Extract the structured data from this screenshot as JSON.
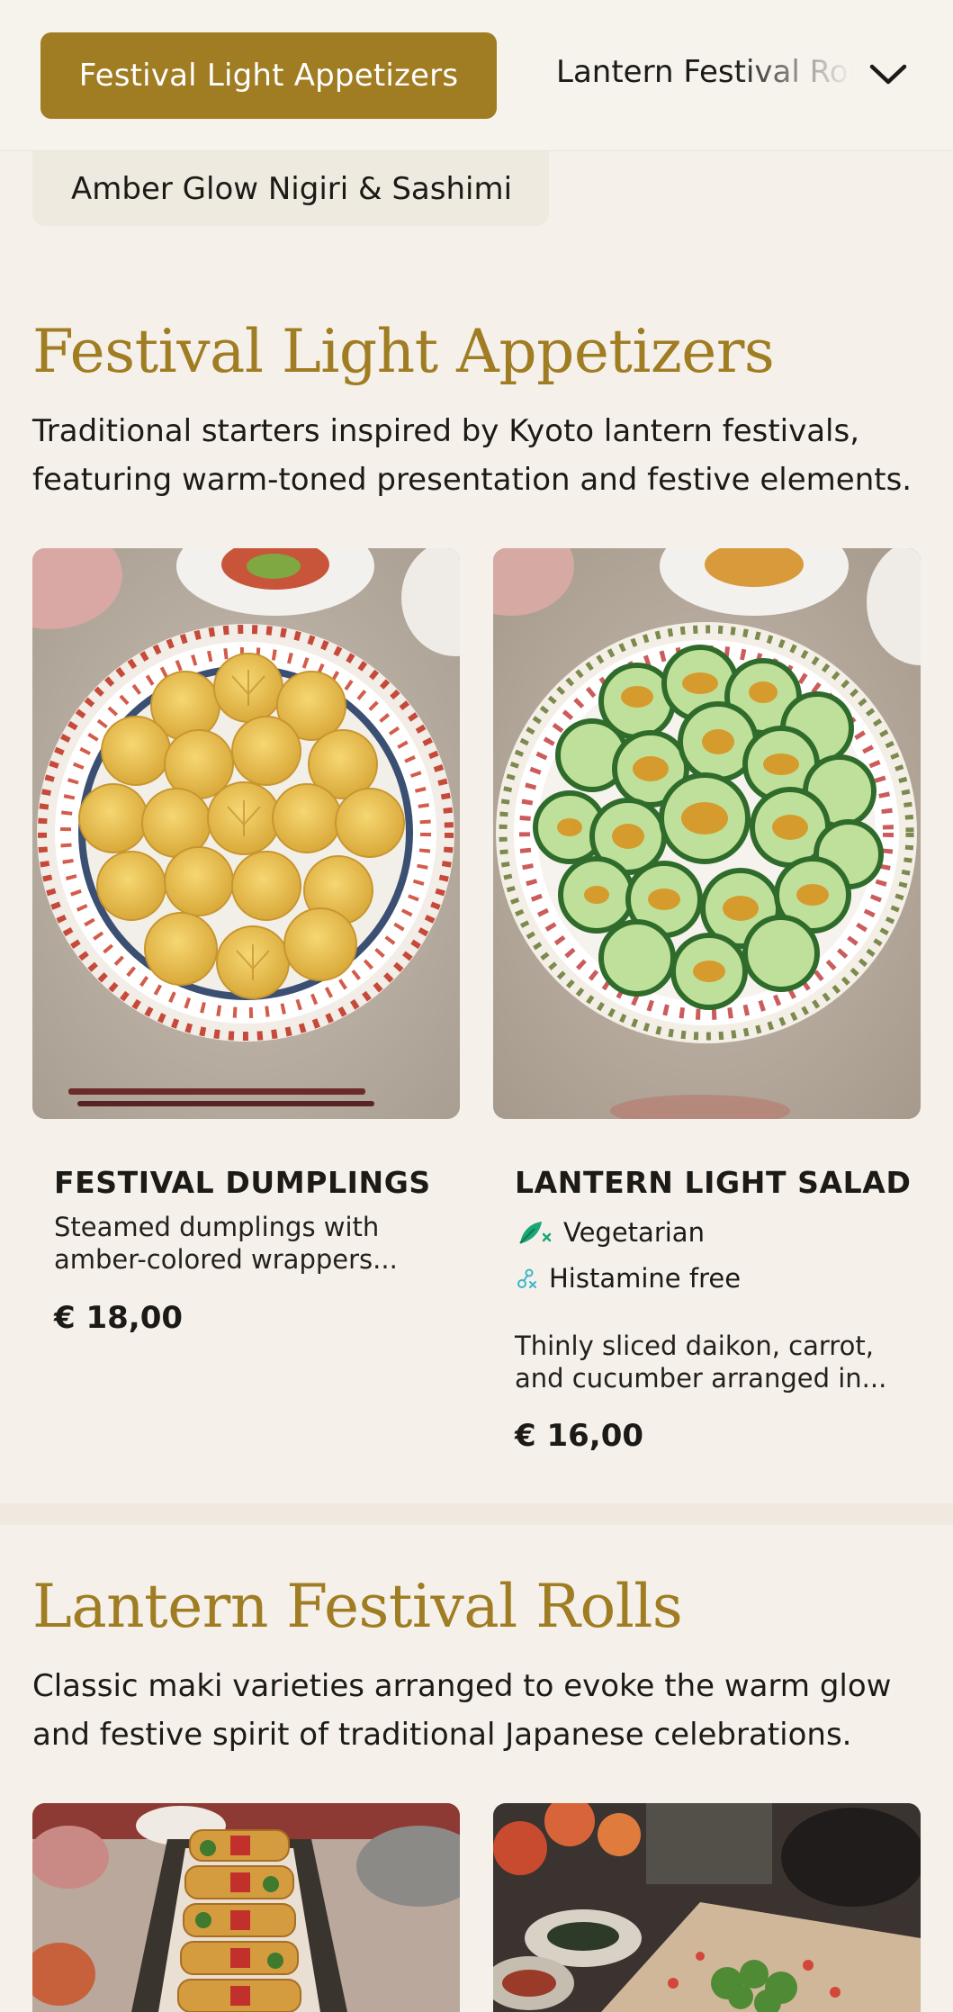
{
  "nav": {
    "active_category": "Festival Light Appetizers",
    "next_category": "Lantern Festival Rolls",
    "secondary_category": "Amber Glow Nigiri & Sashimi",
    "dropdown_icon": "chevron-down-icon"
  },
  "sections": [
    {
      "title": "Festival Light Appetizers",
      "description": "Traditional starters inspired by Kyoto lantern festivals, featuring warm-toned presentation and festive elements.",
      "items": [
        {
          "name": "FESTIVAL DUMPLINGS",
          "description": "Steamed dumplings with amber-colored wrappers...",
          "price": "€ 18,00",
          "image": "dumplings-on-floral-plate"
        },
        {
          "name": "LANTERN LIGHT SALAD",
          "tags": [
            {
              "label": "Vegetarian",
              "icon": "vegetarian-icon",
              "color": "#1aa676"
            },
            {
              "label": "Histamine free",
              "icon": "histamine-free-icon",
              "color": "#3bb6c9"
            }
          ],
          "description": "Thinly sliced daikon, carrot, and cucumber arranged in...",
          "price": "€ 16,00",
          "image": "cucumber-salad-on-floral-plate"
        }
      ]
    },
    {
      "title": "Lantern Festival Rolls",
      "description": "Classic maki varieties arranged to evoke the warm glow and festive spirit of traditional Japanese celebrations.",
      "items": [
        {
          "image": "festive-rolls-platter"
        },
        {
          "image": "lantern-table-spread"
        }
      ]
    }
  ],
  "colors": {
    "accent": "#a07c22",
    "background": "#f5f1ea",
    "text": "#1c1a17"
  }
}
